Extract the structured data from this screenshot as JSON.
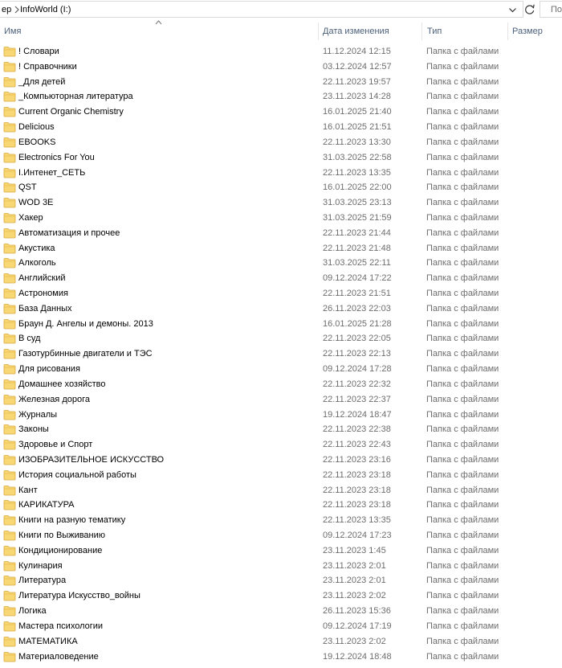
{
  "address_bar": {
    "prev_crumb": "ер",
    "current": "InfoWorld (I:)",
    "search_placeholder": "По"
  },
  "columns": {
    "name": "Имя",
    "date": "Дата изменения",
    "type": "Тип",
    "size": "Размер"
  },
  "icons": {
    "folder": "folder-icon",
    "sort": "sort-ascending-icon",
    "refresh": "refresh-icon",
    "dropdown": "chevron-down-icon",
    "separator": "chevron-right-icon"
  },
  "colors": {
    "folder": "#f8d775",
    "header_text": "#4c607a",
    "secondary_text": "#6d6d6d"
  },
  "files": [
    {
      "name": "! Словари",
      "date": "11.12.2024 12:15",
      "type": "Папка с файлами"
    },
    {
      "name": "! Справочники",
      "date": "03.12.2024 12:57",
      "type": "Папка с файлами"
    },
    {
      "name": "_Для детей",
      "date": "22.11.2023 19:57",
      "type": "Папка с файлами"
    },
    {
      "name": "_Компьюторная литература",
      "date": "23.11.2023 14:28",
      "type": "Папка с файлами"
    },
    {
      "name": "Current Organic Chemistry",
      "date": "16.01.2025 21:40",
      "type": "Папка с файлами"
    },
    {
      "name": "Delicious",
      "date": "16.01.2025 21:51",
      "type": "Папка с файлами"
    },
    {
      "name": "EBOOKS",
      "date": "22.11.2023 13:30",
      "type": "Папка с файлами"
    },
    {
      "name": "Electronics For You",
      "date": "31.03.2025 22:58",
      "type": "Папка с файлами"
    },
    {
      "name": "I.Интенет_СЕТЬ",
      "date": "22.11.2023 13:35",
      "type": "Папка с файлами"
    },
    {
      "name": "QST",
      "date": "16.01.2025 22:00",
      "type": "Папка с файлами"
    },
    {
      "name": "WOD 3E",
      "date": "31.03.2025 23:13",
      "type": "Папка с файлами"
    },
    {
      "name": "Хакер",
      "date": "31.03.2025 21:59",
      "type": "Папка с файлами"
    },
    {
      "name": "Автоматизация и прочее",
      "date": "22.11.2023 21:44",
      "type": "Папка с файлами"
    },
    {
      "name": "Акустика",
      "date": "22.11.2023 21:48",
      "type": "Папка с файлами"
    },
    {
      "name": "Алкоголь",
      "date": "31.03.2025 22:11",
      "type": "Папка с файлами"
    },
    {
      "name": "Английский",
      "date": "09.12.2024 17:22",
      "type": "Папка с файлами"
    },
    {
      "name": "Астрономия",
      "date": "22.11.2023 21:51",
      "type": "Папка с файлами"
    },
    {
      "name": "База Данных",
      "date": "26.11.2023 22:03",
      "type": "Папка с файлами"
    },
    {
      "name": "Браун Д. Ангелы и демоны. 2013",
      "date": "16.01.2025 21:28",
      "type": "Папка с файлами"
    },
    {
      "name": "В суд",
      "date": "22.11.2023 22:05",
      "type": "Папка с файлами"
    },
    {
      "name": "Газотурбинные двигатели и ТЭС",
      "date": "22.11.2023 22:13",
      "type": "Папка с файлами"
    },
    {
      "name": "Для рисования",
      "date": "09.12.2024 17:28",
      "type": "Папка с файлами"
    },
    {
      "name": "Домашнее хозяйство",
      "date": "22.11.2023 22:32",
      "type": "Папка с файлами"
    },
    {
      "name": "Железная дорога",
      "date": "22.11.2023 22:37",
      "type": "Папка с файлами"
    },
    {
      "name": "Журналы",
      "date": "19.12.2024 18:47",
      "type": "Папка с файлами"
    },
    {
      "name": "Законы",
      "date": "22.11.2023 22:38",
      "type": "Папка с файлами"
    },
    {
      "name": "Здоровье и Спорт",
      "date": "22.11.2023 22:43",
      "type": "Папка с файлами"
    },
    {
      "name": "ИЗОБРАЗИТЕЛЬНОЕ ИСКУССТВО",
      "date": "22.11.2023 23:16",
      "type": "Папка с файлами"
    },
    {
      "name": "История социальной работы",
      "date": "22.11.2023 23:18",
      "type": "Папка с файлами"
    },
    {
      "name": "Кант",
      "date": "22.11.2023 23:18",
      "type": "Папка с файлами"
    },
    {
      "name": "КАРИКАТУРА",
      "date": "22.11.2023 23:18",
      "type": "Папка с файлами"
    },
    {
      "name": "Книги на разную тематику",
      "date": "22.11.2023 13:35",
      "type": "Папка с файлами"
    },
    {
      "name": "Книги по Выживанию",
      "date": "09.12.2024 17:23",
      "type": "Папка с файлами"
    },
    {
      "name": "Кондиционирование",
      "date": "23.11.2023 1:45",
      "type": "Папка с файлами"
    },
    {
      "name": "Кулинария",
      "date": "23.11.2023 2:01",
      "type": "Папка с файлами"
    },
    {
      "name": "Литература",
      "date": "23.11.2023 2:01",
      "type": "Папка с файлами"
    },
    {
      "name": "Литература Искусство_войны",
      "date": "23.11.2023 2:02",
      "type": "Папка с файлами"
    },
    {
      "name": "Логика",
      "date": "26.11.2023 15:36",
      "type": "Папка с файлами"
    },
    {
      "name": "Мастера психологии",
      "date": "09.12.2024 17:19",
      "type": "Папка с файлами"
    },
    {
      "name": "МАТЕМАТИКА",
      "date": "23.11.2023 2:02",
      "type": "Папка с файлами"
    },
    {
      "name": "Материаловедение",
      "date": "19.12.2024 18:48",
      "type": "Папка с файлами"
    }
  ]
}
